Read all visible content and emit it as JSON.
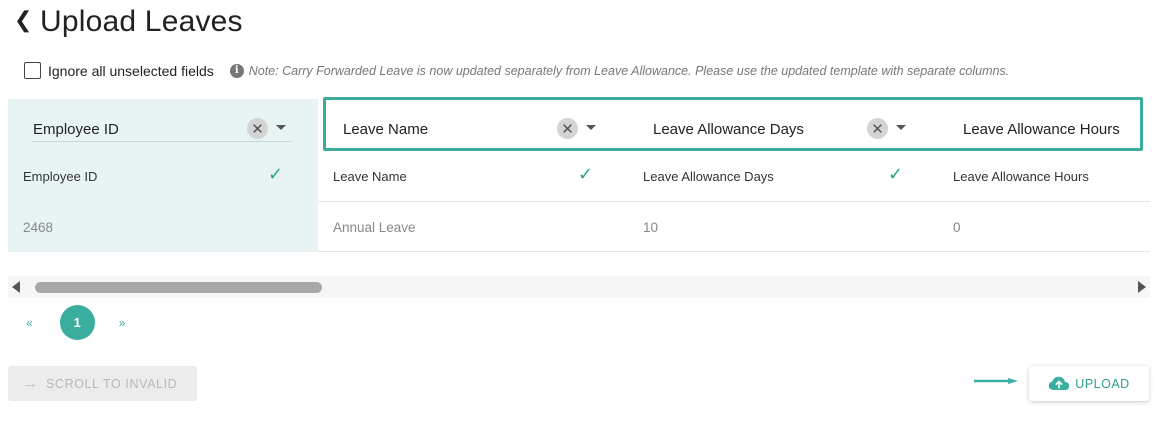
{
  "header": {
    "back_icon": "chevron-left-icon",
    "title": "Upload Leaves"
  },
  "options": {
    "ignore_label": "Ignore all unselected fields",
    "ignore_checked": false,
    "note": "Note: Carry Forwarded Leave is now updated separately from Leave Allowance. Please use the updated template with separate columns."
  },
  "columns": [
    {
      "header": "Employee ID",
      "mapped": "Employee ID",
      "value": "2468"
    },
    {
      "header": "Leave Name",
      "mapped": "Leave Name",
      "value": "Annual Leave"
    },
    {
      "header": "Leave Allowance Days",
      "mapped": "Leave Allowance Days",
      "value": "10"
    },
    {
      "header": "Leave Allowance Hours",
      "mapped": "Leave Allowance Hours",
      "value": "0"
    }
  ],
  "pagination": {
    "prev": "«",
    "current": "1",
    "next": "»"
  },
  "actions": {
    "scroll_invalid": "SCROLL TO INVALID",
    "upload": "UPLOAD"
  },
  "colors": {
    "accent": "#3aae9e",
    "check": "#2aa876",
    "first_col_bg": "#e8f4f4"
  }
}
